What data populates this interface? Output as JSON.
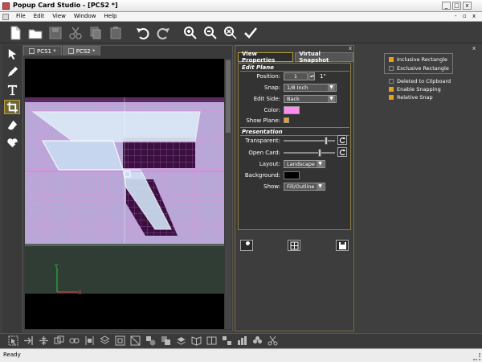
{
  "window": {
    "title": "Popup Card Studio - [PCS2 *]",
    "minimize": "_",
    "maximize": "□",
    "close": "x"
  },
  "menu": {
    "items": [
      "File",
      "Edit",
      "View",
      "Window",
      "Help"
    ],
    "mdi_min": "-",
    "mdi_max": "▫",
    "mdi_close": "x"
  },
  "doc_tabs": [
    {
      "label": "PCS1 *"
    },
    {
      "label": "PCS2 *"
    }
  ],
  "props": {
    "tabs": [
      "View Properties",
      "Virtual Snapshot"
    ],
    "edit_plane": {
      "title": "Edit Plane",
      "position_label": "Position:",
      "position_value": "1",
      "position_unit": "1\"",
      "snap_label": "Snap:",
      "snap_value": "1/8 Inch",
      "edit_side_label": "Edit Side:",
      "edit_side_value": "Back",
      "color_label": "Color:",
      "color_value": "#ff8cf0",
      "show_plane_label": "Show Plane:"
    },
    "presentation": {
      "title": "Presentation",
      "transparent_label": "Transparent:",
      "transparent_level": 0.85,
      "open_card_label": "Open Card:",
      "open_card_level": 0.72,
      "layout_label": "Layout:",
      "layout_value": "Landscape",
      "background_label": "Background:",
      "background_value": "#000000",
      "show_label": "Show:",
      "show_value": "Fill/Outline"
    }
  },
  "snap": {
    "items": [
      {
        "label": "Inclusive Rectangle",
        "on": true
      },
      {
        "label": "Exclusive Rectangle",
        "on": false
      },
      {
        "label": "Deleted to Clipboard",
        "on": false
      },
      {
        "label": "Enable Snapping",
        "on": true
      },
      {
        "label": "Relative Snap",
        "on": true
      }
    ]
  },
  "axes": {
    "y": "Y",
    "x": "X"
  },
  "status": {
    "text": "Ready"
  },
  "colors": {
    "accent": "#e6a21a",
    "panel_border": "#8a7a40",
    "plane": "#b8a8d8"
  }
}
